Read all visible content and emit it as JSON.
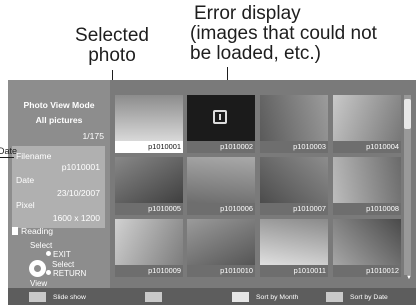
{
  "callouts": {
    "selected_line1": "Selected",
    "selected_line2": "photo",
    "error_line1": "Error display",
    "error_line2": "(images that could not",
    "error_line3": "be loaded, etc.)",
    "date_label": "Date"
  },
  "sidepanel": {
    "mode": "Photo View Mode",
    "folder": "All pictures",
    "count": "1/175",
    "filename_label": "Filename",
    "filename_value": "p1010001",
    "date_label": "Date",
    "date_value": "23/10/2007",
    "pixel_label": "Pixel",
    "pixel_value": "1600 x 1200",
    "reading": "Reading",
    "select_top": "Select",
    "exit": "EXIT",
    "select_mid": "Select",
    "return": "RETURN",
    "view": "View"
  },
  "thumbnails": [
    {
      "caption": "p1010001",
      "state": "selected",
      "palette": [
        "#d9d9d9",
        "#8c8c8c"
      ]
    },
    {
      "caption": "p1010002",
      "state": "error",
      "palette": [
        "#1b1b1b",
        "#1b1b1b"
      ]
    },
    {
      "caption": "p1010003",
      "state": "normal",
      "palette": [
        "#5a5a5a",
        "#9c9c9c"
      ]
    },
    {
      "caption": "p1010004",
      "state": "normal",
      "palette": [
        "#c9c9c9",
        "#777777"
      ]
    },
    {
      "caption": "p1010005",
      "state": "normal",
      "palette": [
        "#888888",
        "#3f3f3f"
      ]
    },
    {
      "caption": "p1010006",
      "state": "normal",
      "palette": [
        "#6d6d6d",
        "#a9a9a9"
      ]
    },
    {
      "caption": "p1010007",
      "state": "normal",
      "palette": [
        "#4c4c4c",
        "#8d8d8d"
      ]
    },
    {
      "caption": "p1010008",
      "state": "normal",
      "palette": [
        "#bdbdbd",
        "#6a6a6a"
      ]
    },
    {
      "caption": "p1010009",
      "state": "normal",
      "palette": [
        "#d1d1d1",
        "#7c7c7c"
      ]
    },
    {
      "caption": "p1010010",
      "state": "normal",
      "palette": [
        "#9b9b9b",
        "#555555"
      ]
    },
    {
      "caption": "p1010011",
      "state": "normal",
      "palette": [
        "#e0e0e0",
        "#8a8a8a"
      ]
    },
    {
      "caption": "p1010012",
      "state": "normal",
      "palette": [
        "#a7a7a7",
        "#4a4a4a"
      ]
    }
  ],
  "bottom_bar": {
    "btn1": {
      "label": "Slide show",
      "color": "#c9c9c9"
    },
    "btn2": {
      "label": "",
      "color": "#c9c9c9"
    },
    "btn3": {
      "label": "Sort by Month",
      "color": "#e6e6e6"
    },
    "btn4": {
      "label": "Sort by Date",
      "color": "#c9c9c9"
    }
  },
  "icons": [
    "error-icon",
    "document-icon",
    "dpad-icon",
    "scroll-down-arrow-icon"
  ]
}
